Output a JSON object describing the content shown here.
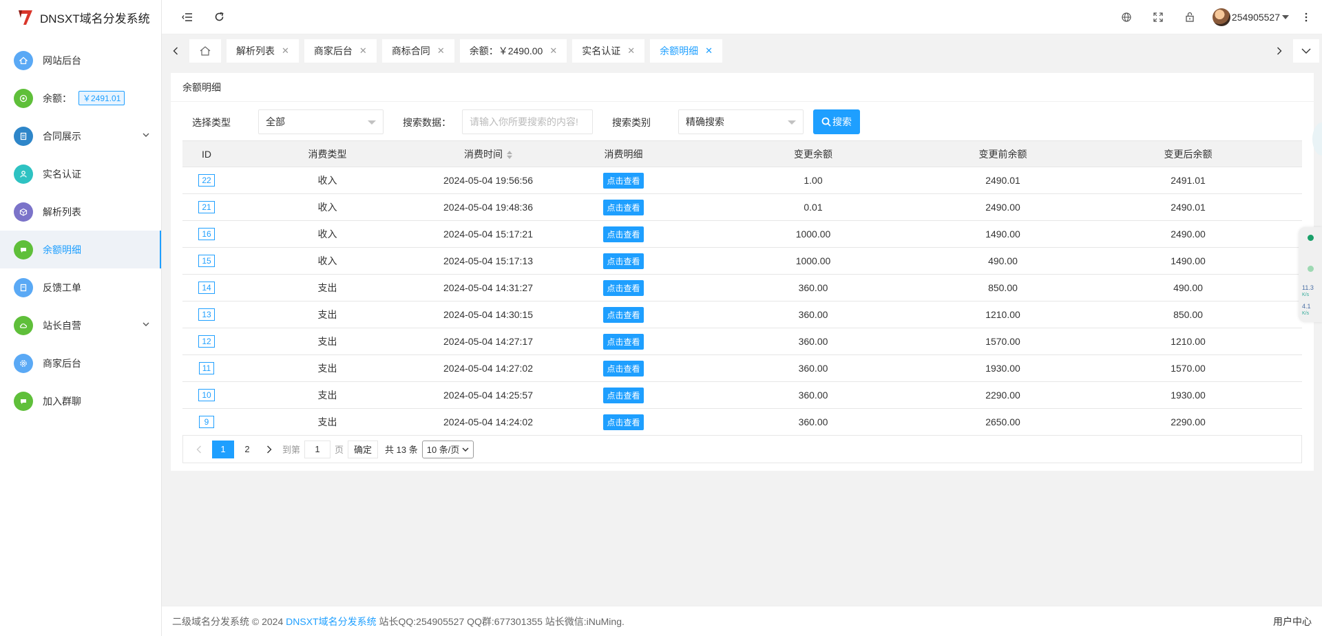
{
  "app": {
    "title": "DNSXT域名分发系统"
  },
  "sidebar": {
    "items": [
      {
        "label": "网站后台",
        "color": "#5aa9f5",
        "icon": "home-icon"
      },
      {
        "label": "余额：",
        "badge": "￥2491.01",
        "color": "#5fbf3a",
        "icon": "wallet-icon"
      },
      {
        "label": "合同展示",
        "color": "#2e86c9",
        "icon": "document-icon",
        "expandable": true
      },
      {
        "label": "实名认证",
        "color": "#2ec2c2",
        "icon": "user-check-icon"
      },
      {
        "label": "解析列表",
        "color": "#7b73c9",
        "icon": "cube-icon"
      },
      {
        "label": "余额明细",
        "color": "#5fbf3a",
        "icon": "chat-icon",
        "active": true
      },
      {
        "label": "反馈工单",
        "color": "#5aa9f5",
        "icon": "ticket-icon"
      },
      {
        "label": "站长自营",
        "color": "#5fbf3a",
        "icon": "cloud-icon",
        "expandable": true
      },
      {
        "label": "商家后台",
        "color": "#5aa9f5",
        "icon": "settings-icon"
      },
      {
        "label": "加入群聊",
        "color": "#5fbf3a",
        "icon": "chat-icon"
      }
    ]
  },
  "topbar": {
    "username": "254905527"
  },
  "tabs": [
    {
      "label": "解析列表"
    },
    {
      "label": "商家后台"
    },
    {
      "label": "商标合同"
    },
    {
      "label": "余额：￥2490.00"
    },
    {
      "label": "实名认证"
    },
    {
      "label": "余额明细",
      "active": true
    }
  ],
  "panel": {
    "title": "余额明细",
    "filter": {
      "type_label": "选择类型",
      "type_value": "全部",
      "data_label": "搜索数据：",
      "data_placeholder": "请输入你所要搜索的内容!",
      "mode_label": "搜索类别",
      "mode_value": "精确搜索",
      "search_button": "搜索"
    },
    "table": {
      "headers": [
        "ID",
        "消费类型",
        "消费时间",
        "消费明细",
        "变更余额",
        "变更前余额",
        "变更后余额"
      ],
      "view_label": "点击查看",
      "rows": [
        {
          "id": "22",
          "type": "收入",
          "time": "2024-05-04 19:56:56",
          "change": "1.00",
          "before": "2490.01",
          "after": "2491.01"
        },
        {
          "id": "21",
          "type": "收入",
          "time": "2024-05-04 19:48:36",
          "change": "0.01",
          "before": "2490.00",
          "after": "2490.01"
        },
        {
          "id": "16",
          "type": "收入",
          "time": "2024-05-04 15:17:21",
          "change": "1000.00",
          "before": "1490.00",
          "after": "2490.00"
        },
        {
          "id": "15",
          "type": "收入",
          "time": "2024-05-04 15:17:13",
          "change": "1000.00",
          "before": "490.00",
          "after": "1490.00"
        },
        {
          "id": "14",
          "type": "支出",
          "time": "2024-05-04 14:31:27",
          "change": "360.00",
          "before": "850.00",
          "after": "490.00"
        },
        {
          "id": "13",
          "type": "支出",
          "time": "2024-05-04 14:30:15",
          "change": "360.00",
          "before": "1210.00",
          "after": "850.00"
        },
        {
          "id": "12",
          "type": "支出",
          "time": "2024-05-04 14:27:17",
          "change": "360.00",
          "before": "1570.00",
          "after": "1210.00"
        },
        {
          "id": "11",
          "type": "支出",
          "time": "2024-05-04 14:27:02",
          "change": "360.00",
          "before": "1930.00",
          "after": "1570.00"
        },
        {
          "id": "10",
          "type": "支出",
          "time": "2024-05-04 14:25:57",
          "change": "360.00",
          "before": "2290.00",
          "after": "1930.00"
        },
        {
          "id": "9",
          "type": "支出",
          "time": "2024-05-04 14:24:02",
          "change": "360.00",
          "before": "2650.00",
          "after": "2290.00"
        }
      ]
    },
    "pager": {
      "pages": [
        "1",
        "2"
      ],
      "current": "1",
      "goto_label": "到第",
      "goto_value": "1",
      "page_unit": "页",
      "confirm": "确定",
      "total": "共 13 条",
      "page_size": "10 条/页"
    }
  },
  "float_widget": {
    "upload": "11.3",
    "upload_unit": "K/s",
    "download": "4.1",
    "download_unit": "K/s"
  },
  "footer": {
    "prefix": "二级域名分发系统 © 2024",
    "link": "DNSXT域名分发系统",
    "suffix": "站长QQ:254905527 QQ群:677301355 站长微信:iNuMing.",
    "right": "用户中心"
  },
  "colors": {
    "accent": "#1e9fff",
    "sidebar_bg": "#ffffff",
    "page_bg": "#f2f2f2"
  }
}
